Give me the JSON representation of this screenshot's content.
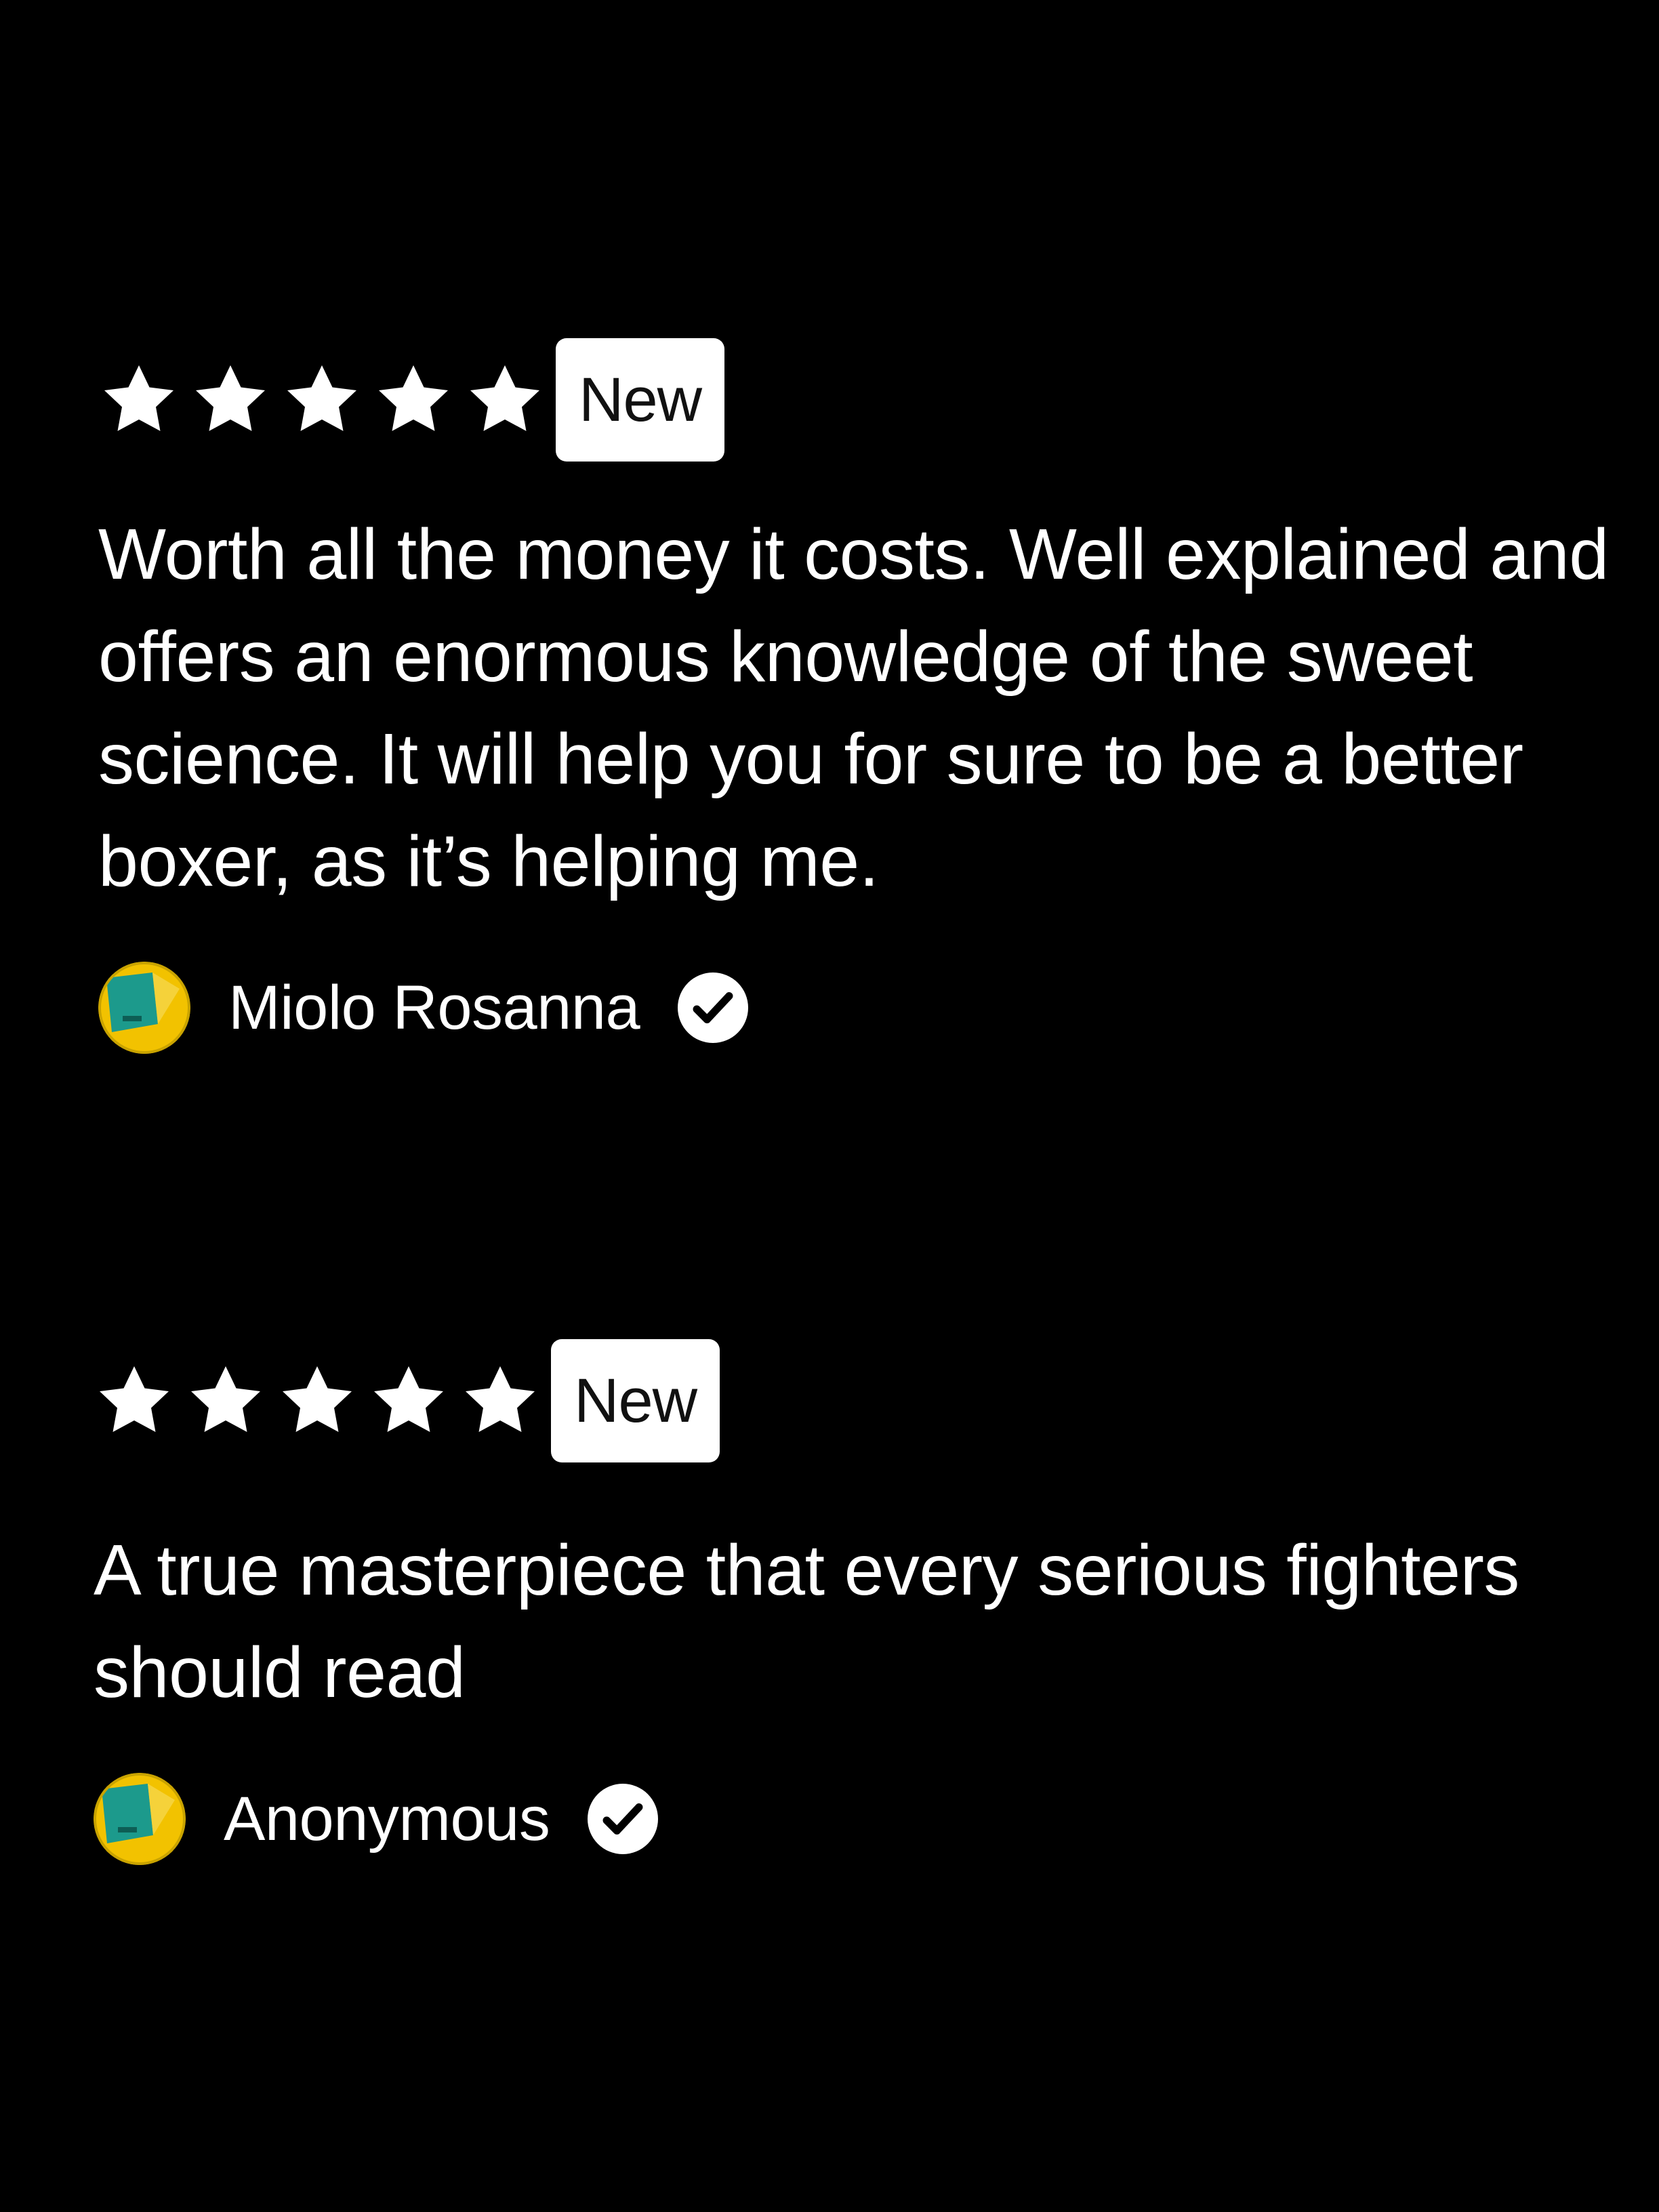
{
  "reviews": [
    {
      "rating": 5,
      "rating_max": 5,
      "badge": "New",
      "text": "Worth all the money it costs. Well explained and offers an enormous knowledge of the sweet science. It will help you for sure to be a better boxer, as it’s helping me.",
      "author": "Miolo Rosanna",
      "verified": true
    },
    {
      "rating": 5,
      "rating_max": 5,
      "badge": "New",
      "text": "A true masterpiece that every serious fighters should read",
      "author": "Anonymous",
      "verified": true
    }
  ],
  "icons": {
    "star": "star-icon",
    "verified": "check-circle-icon",
    "avatar": "avatar-image"
  },
  "colors": {
    "background": "#000000",
    "text": "#ffffff",
    "badge_bg": "#ffffff",
    "badge_text": "#111111",
    "avatar_yellow": "#f2c200",
    "avatar_teal": "#1c9a8c"
  }
}
